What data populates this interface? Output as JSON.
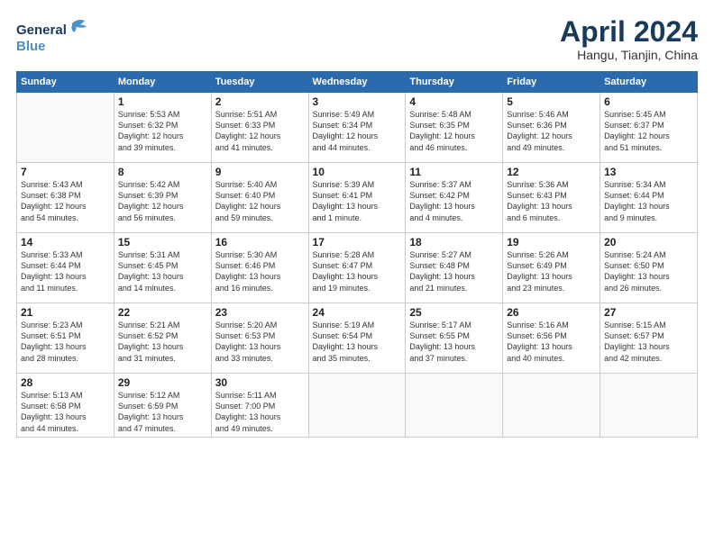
{
  "header": {
    "logo_line1": "General",
    "logo_line2": "Blue",
    "month": "April 2024",
    "location": "Hangu, Tianjin, China"
  },
  "days_of_week": [
    "Sunday",
    "Monday",
    "Tuesday",
    "Wednesday",
    "Thursday",
    "Friday",
    "Saturday"
  ],
  "weeks": [
    [
      {
        "day": "",
        "info": ""
      },
      {
        "day": "1",
        "info": "Sunrise: 5:53 AM\nSunset: 6:32 PM\nDaylight: 12 hours\nand 39 minutes."
      },
      {
        "day": "2",
        "info": "Sunrise: 5:51 AM\nSunset: 6:33 PM\nDaylight: 12 hours\nand 41 minutes."
      },
      {
        "day": "3",
        "info": "Sunrise: 5:49 AM\nSunset: 6:34 PM\nDaylight: 12 hours\nand 44 minutes."
      },
      {
        "day": "4",
        "info": "Sunrise: 5:48 AM\nSunset: 6:35 PM\nDaylight: 12 hours\nand 46 minutes."
      },
      {
        "day": "5",
        "info": "Sunrise: 5:46 AM\nSunset: 6:36 PM\nDaylight: 12 hours\nand 49 minutes."
      },
      {
        "day": "6",
        "info": "Sunrise: 5:45 AM\nSunset: 6:37 PM\nDaylight: 12 hours\nand 51 minutes."
      }
    ],
    [
      {
        "day": "7",
        "info": "Sunrise: 5:43 AM\nSunset: 6:38 PM\nDaylight: 12 hours\nand 54 minutes."
      },
      {
        "day": "8",
        "info": "Sunrise: 5:42 AM\nSunset: 6:39 PM\nDaylight: 12 hours\nand 56 minutes."
      },
      {
        "day": "9",
        "info": "Sunrise: 5:40 AM\nSunset: 6:40 PM\nDaylight: 12 hours\nand 59 minutes."
      },
      {
        "day": "10",
        "info": "Sunrise: 5:39 AM\nSunset: 6:41 PM\nDaylight: 13 hours\nand 1 minute."
      },
      {
        "day": "11",
        "info": "Sunrise: 5:37 AM\nSunset: 6:42 PM\nDaylight: 13 hours\nand 4 minutes."
      },
      {
        "day": "12",
        "info": "Sunrise: 5:36 AM\nSunset: 6:43 PM\nDaylight: 13 hours\nand 6 minutes."
      },
      {
        "day": "13",
        "info": "Sunrise: 5:34 AM\nSunset: 6:44 PM\nDaylight: 13 hours\nand 9 minutes."
      }
    ],
    [
      {
        "day": "14",
        "info": "Sunrise: 5:33 AM\nSunset: 6:44 PM\nDaylight: 13 hours\nand 11 minutes."
      },
      {
        "day": "15",
        "info": "Sunrise: 5:31 AM\nSunset: 6:45 PM\nDaylight: 13 hours\nand 14 minutes."
      },
      {
        "day": "16",
        "info": "Sunrise: 5:30 AM\nSunset: 6:46 PM\nDaylight: 13 hours\nand 16 minutes."
      },
      {
        "day": "17",
        "info": "Sunrise: 5:28 AM\nSunset: 6:47 PM\nDaylight: 13 hours\nand 19 minutes."
      },
      {
        "day": "18",
        "info": "Sunrise: 5:27 AM\nSunset: 6:48 PM\nDaylight: 13 hours\nand 21 minutes."
      },
      {
        "day": "19",
        "info": "Sunrise: 5:26 AM\nSunset: 6:49 PM\nDaylight: 13 hours\nand 23 minutes."
      },
      {
        "day": "20",
        "info": "Sunrise: 5:24 AM\nSunset: 6:50 PM\nDaylight: 13 hours\nand 26 minutes."
      }
    ],
    [
      {
        "day": "21",
        "info": "Sunrise: 5:23 AM\nSunset: 6:51 PM\nDaylight: 13 hours\nand 28 minutes."
      },
      {
        "day": "22",
        "info": "Sunrise: 5:21 AM\nSunset: 6:52 PM\nDaylight: 13 hours\nand 31 minutes."
      },
      {
        "day": "23",
        "info": "Sunrise: 5:20 AM\nSunset: 6:53 PM\nDaylight: 13 hours\nand 33 minutes."
      },
      {
        "day": "24",
        "info": "Sunrise: 5:19 AM\nSunset: 6:54 PM\nDaylight: 13 hours\nand 35 minutes."
      },
      {
        "day": "25",
        "info": "Sunrise: 5:17 AM\nSunset: 6:55 PM\nDaylight: 13 hours\nand 37 minutes."
      },
      {
        "day": "26",
        "info": "Sunrise: 5:16 AM\nSunset: 6:56 PM\nDaylight: 13 hours\nand 40 minutes."
      },
      {
        "day": "27",
        "info": "Sunrise: 5:15 AM\nSunset: 6:57 PM\nDaylight: 13 hours\nand 42 minutes."
      }
    ],
    [
      {
        "day": "28",
        "info": "Sunrise: 5:13 AM\nSunset: 6:58 PM\nDaylight: 13 hours\nand 44 minutes."
      },
      {
        "day": "29",
        "info": "Sunrise: 5:12 AM\nSunset: 6:59 PM\nDaylight: 13 hours\nand 47 minutes."
      },
      {
        "day": "30",
        "info": "Sunrise: 5:11 AM\nSunset: 7:00 PM\nDaylight: 13 hours\nand 49 minutes."
      },
      {
        "day": "",
        "info": ""
      },
      {
        "day": "",
        "info": ""
      },
      {
        "day": "",
        "info": ""
      },
      {
        "day": "",
        "info": ""
      }
    ]
  ]
}
